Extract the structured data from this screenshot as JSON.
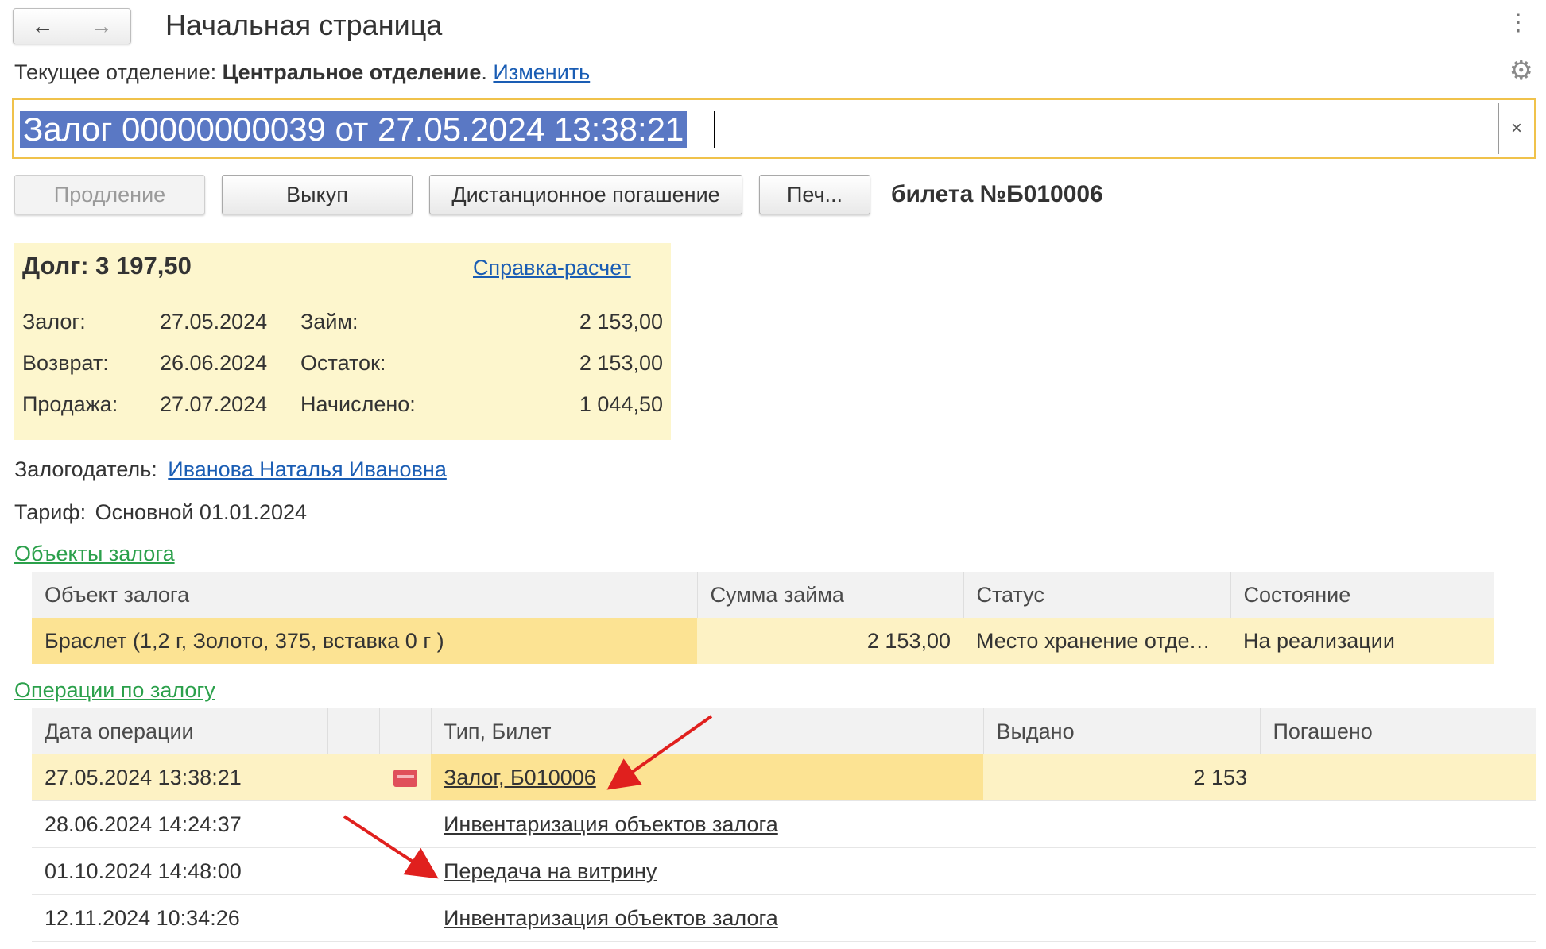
{
  "header": {
    "title": "Начальная страница",
    "back": "←",
    "forward": "→",
    "more": "⋮"
  },
  "department": {
    "label": "Текущее отделение:",
    "name": "Центральное отделение",
    "dot": ".",
    "change_link": "Изменить"
  },
  "search": {
    "value": "Залог 00000000039 от 27.05.2024 13:38:21",
    "clear": "×"
  },
  "actions": {
    "renew": "Продление",
    "buyout": "Выкуп",
    "remote_payment": "Дистанционное погашение",
    "print": "Печ...",
    "ticket_label": "билета №Б010006"
  },
  "debt": {
    "title": "Долг: 3 197,50",
    "calc_link": "Справка-расчет",
    "pledge_label": "Залог:",
    "pledge_date": "27.05.2024",
    "return_label": "Возврат:",
    "return_date": "26.06.2024",
    "sale_label": "Продажа:",
    "sale_date": "27.07.2024",
    "loan_label": "Займ:",
    "loan_value": "2 153,00",
    "rest_label": "Остаток:",
    "rest_value": "2 153,00",
    "accrued_label": "Начислено:",
    "accrued_value": "1 044,50"
  },
  "pledger": {
    "label": "Залогодатель:",
    "name": "Иванова Наталья Ивановна"
  },
  "tariff": {
    "label": "Тариф:",
    "value": "Основной 01.01.2024"
  },
  "objects": {
    "section_title": "Объекты залога",
    "columns": [
      "Объект залога",
      "Сумма займа",
      "Статус",
      "Состояние"
    ],
    "rows": [
      {
        "object": "Браслет (1,2 г, Золото, 375, вставка 0 г )",
        "sum": "2 153,00",
        "status": "Место хранение отделение",
        "state": "На реализации"
      }
    ]
  },
  "operations": {
    "section_title": "Операции по залогу",
    "columns": [
      "Дата операции",
      "",
      "",
      "Тип, Билет",
      "Выдано",
      "Погашено"
    ],
    "rows": [
      {
        "date": "27.05.2024 13:38:21",
        "type": "Залог, Б010006",
        "issued": "2 153",
        "repaid": ""
      },
      {
        "date": "28.06.2024 14:24:37",
        "type": "Инвентаризация объектов залога",
        "issued": "",
        "repaid": ""
      },
      {
        "date": "01.10.2024 14:48:00",
        "type": "Передача на витрину",
        "issued": "",
        "repaid": ""
      },
      {
        "date": "12.11.2024 10:34:26",
        "type": "Инвентаризация объектов залога",
        "issued": "",
        "repaid": ""
      }
    ]
  },
  "colors": {
    "accent_link": "#1a5db4",
    "section_link": "#2ba04b",
    "panel_bg": "#fdf6cd",
    "selection": "#5a78c4",
    "annotation_arrow": "#e0201e"
  }
}
